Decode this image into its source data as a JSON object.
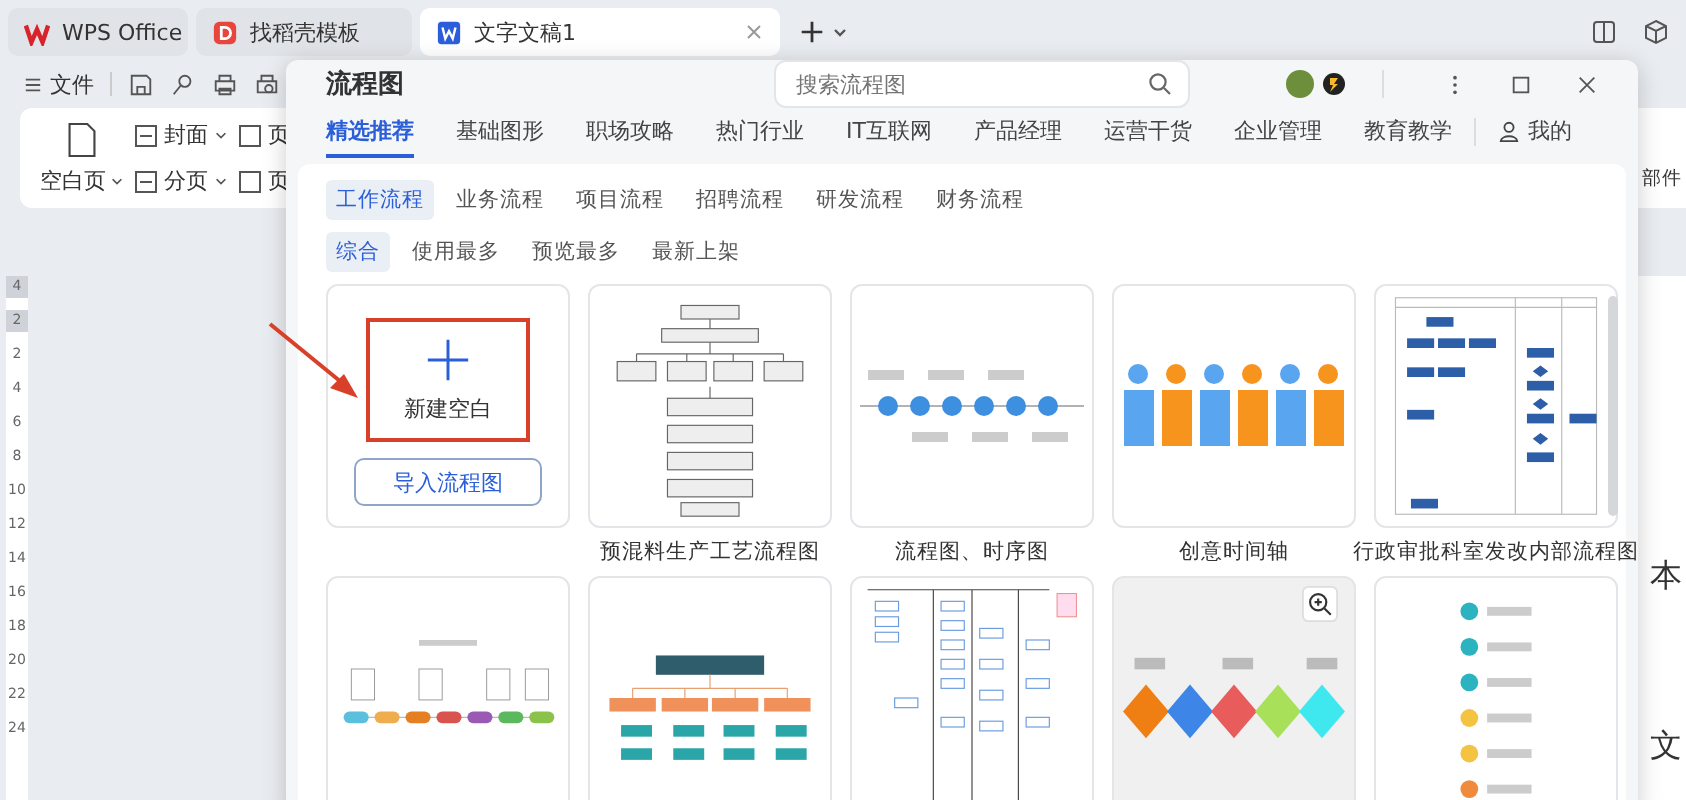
{
  "app_tabs": [
    {
      "label": "WPS Office",
      "kind": "home",
      "selected": false
    },
    {
      "label": "找稻壳模板",
      "kind": "template",
      "selected": false
    },
    {
      "label": "文字文稿1",
      "kind": "doc",
      "selected": true
    }
  ],
  "toolbar": {
    "menu_label": "文件"
  },
  "ribbon": {
    "large": {
      "label": "空白页"
    },
    "small": [
      {
        "label": "封面",
        "caret": true
      },
      {
        "label": "分页",
        "caret": true
      }
    ],
    "cut": [
      {
        "label": "页"
      },
      {
        "label": "页"
      }
    ],
    "right": {
      "label": "部件"
    }
  },
  "ruler_marks": [
    {
      "label": "4",
      "shaded": true
    },
    {
      "label": "2",
      "shaded": true
    },
    {
      "label": "2",
      "shaded": false
    },
    {
      "label": "4",
      "shaded": false
    },
    {
      "label": "6",
      "shaded": false
    },
    {
      "label": "8",
      "shaded": false
    },
    {
      "label": "10",
      "shaded": false
    },
    {
      "label": "12",
      "shaded": false
    },
    {
      "label": "14",
      "shaded": false
    },
    {
      "label": "16",
      "shaded": false
    },
    {
      "label": "18",
      "shaded": false
    },
    {
      "label": "20",
      "shaded": false
    },
    {
      "label": "22",
      "shaded": false
    },
    {
      "label": "24",
      "shaded": false
    }
  ],
  "document_text": [
    "本",
    "文"
  ],
  "dialog": {
    "title": "流程图",
    "search": {
      "placeholder": "搜索流程图"
    },
    "categories": [
      {
        "label": "精选推荐",
        "selected": true
      },
      {
        "label": "基础图形",
        "selected": false
      },
      {
        "label": "职场攻略",
        "selected": false
      },
      {
        "label": "热门行业",
        "selected": false
      },
      {
        "label": "IT互联网",
        "selected": false
      },
      {
        "label": "产品经理",
        "selected": false
      },
      {
        "label": "运营干货",
        "selected": false
      },
      {
        "label": "企业管理",
        "selected": false
      },
      {
        "label": "教育教学",
        "selected": false
      }
    ],
    "my_tab": {
      "label": "我的"
    },
    "sub_tabs": [
      {
        "label": "工作流程",
        "selected": true
      },
      {
        "label": "业务流程",
        "selected": false
      },
      {
        "label": "项目流程",
        "selected": false
      },
      {
        "label": "招聘流程",
        "selected": false
      },
      {
        "label": "研发流程",
        "selected": false
      },
      {
        "label": "财务流程",
        "selected": false
      }
    ],
    "filters": [
      {
        "label": "综合",
        "selected": true
      },
      {
        "label": "使用最多",
        "selected": false
      },
      {
        "label": "预览最多",
        "selected": false
      },
      {
        "label": "最新上架",
        "selected": false
      }
    ],
    "new_card": {
      "label": "新建空白",
      "button": "导入流程图",
      "highlighted": true
    },
    "templates": [
      {
        "kind": "vertical-flow",
        "title": "预混料生产工艺流程图",
        "hovered": false
      },
      {
        "kind": "timeline",
        "title": "流程图、时序图",
        "hovered": false
      },
      {
        "kind": "hex-timeline",
        "title": "创意时间轴",
        "hovered": false
      },
      {
        "kind": "swimlane",
        "title": "行政审批科室发改内部流程图",
        "hovered": false
      },
      {
        "kind": "mindmap",
        "hovered": false
      },
      {
        "kind": "org-chart",
        "hovered": false
      },
      {
        "kind": "dense-flow",
        "hovered": false
      },
      {
        "kind": "diamonds",
        "hovered": true
      },
      {
        "kind": "steps",
        "hovered": false
      }
    ]
  }
}
